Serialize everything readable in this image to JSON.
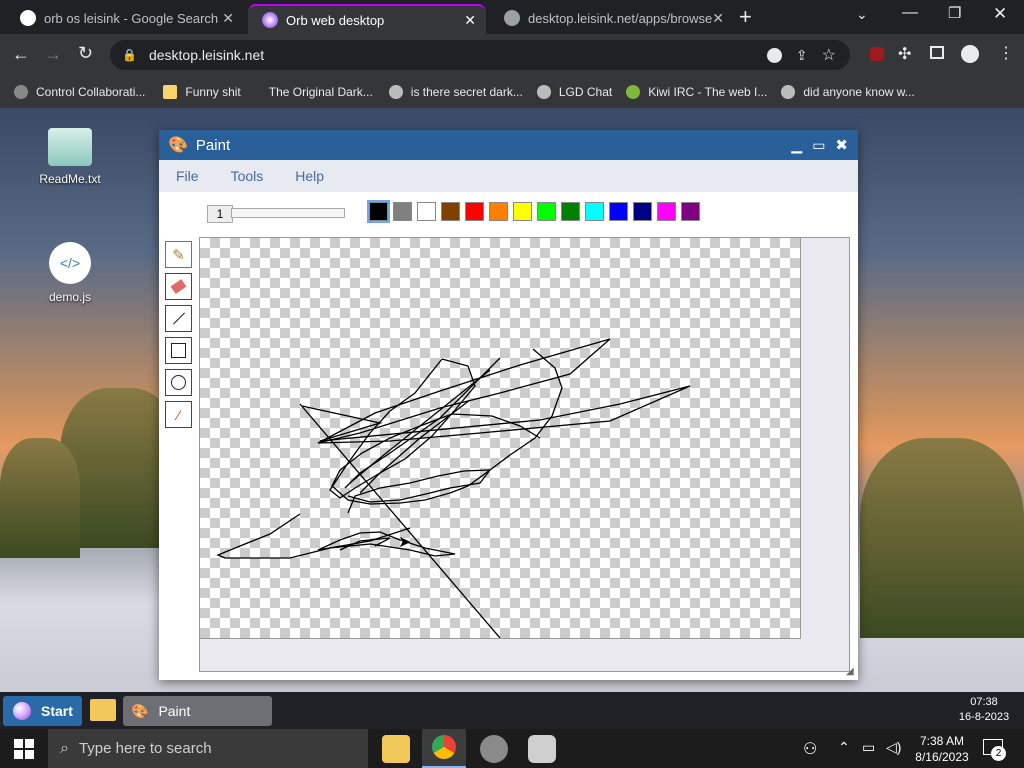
{
  "browser": {
    "tabs": [
      {
        "label": "orb os leisink - Google Search"
      },
      {
        "label": "Orb web desktop"
      },
      {
        "label": "desktop.leisink.net/apps/browse"
      }
    ],
    "url": "desktop.leisink.net",
    "bookmarks": [
      {
        "label": "Control Collaborati..."
      },
      {
        "label": "Funny shit"
      },
      {
        "label": "The Original Dark..."
      },
      {
        "label": "is there secret dark..."
      },
      {
        "label": "LGD Chat"
      },
      {
        "label": "Kiwi IRC - The web I..."
      },
      {
        "label": "did anyone know w..."
      }
    ]
  },
  "desktop": {
    "icons": [
      {
        "label": "ReadMe.txt"
      },
      {
        "label": "demo.js"
      }
    ]
  },
  "paint": {
    "title": "Paint",
    "menu": [
      "File",
      "Tools",
      "Help"
    ],
    "brush_size": "1",
    "palette": [
      "#000000",
      "#808080",
      "#ffffff",
      "#804000",
      "#ff0000",
      "#ff8000",
      "#ffff00",
      "#00ff00",
      "#008000",
      "#00ffff",
      "#0000ff",
      "#000080",
      "#ff00ff",
      "#800080"
    ],
    "tools": [
      "brush-icon",
      "eraser-icon",
      "line-icon",
      "rectangle-icon",
      "circle-icon",
      "color-picker-icon"
    ]
  },
  "orb_taskbar": {
    "start_label": "Start",
    "app_label": "Paint",
    "clock_time": "07:38",
    "clock_date": "16-8-2023"
  },
  "windows_taskbar": {
    "search_placeholder": "Type here to search",
    "time": "7:38 AM",
    "date": "8/16/2023",
    "notifications": "2"
  }
}
